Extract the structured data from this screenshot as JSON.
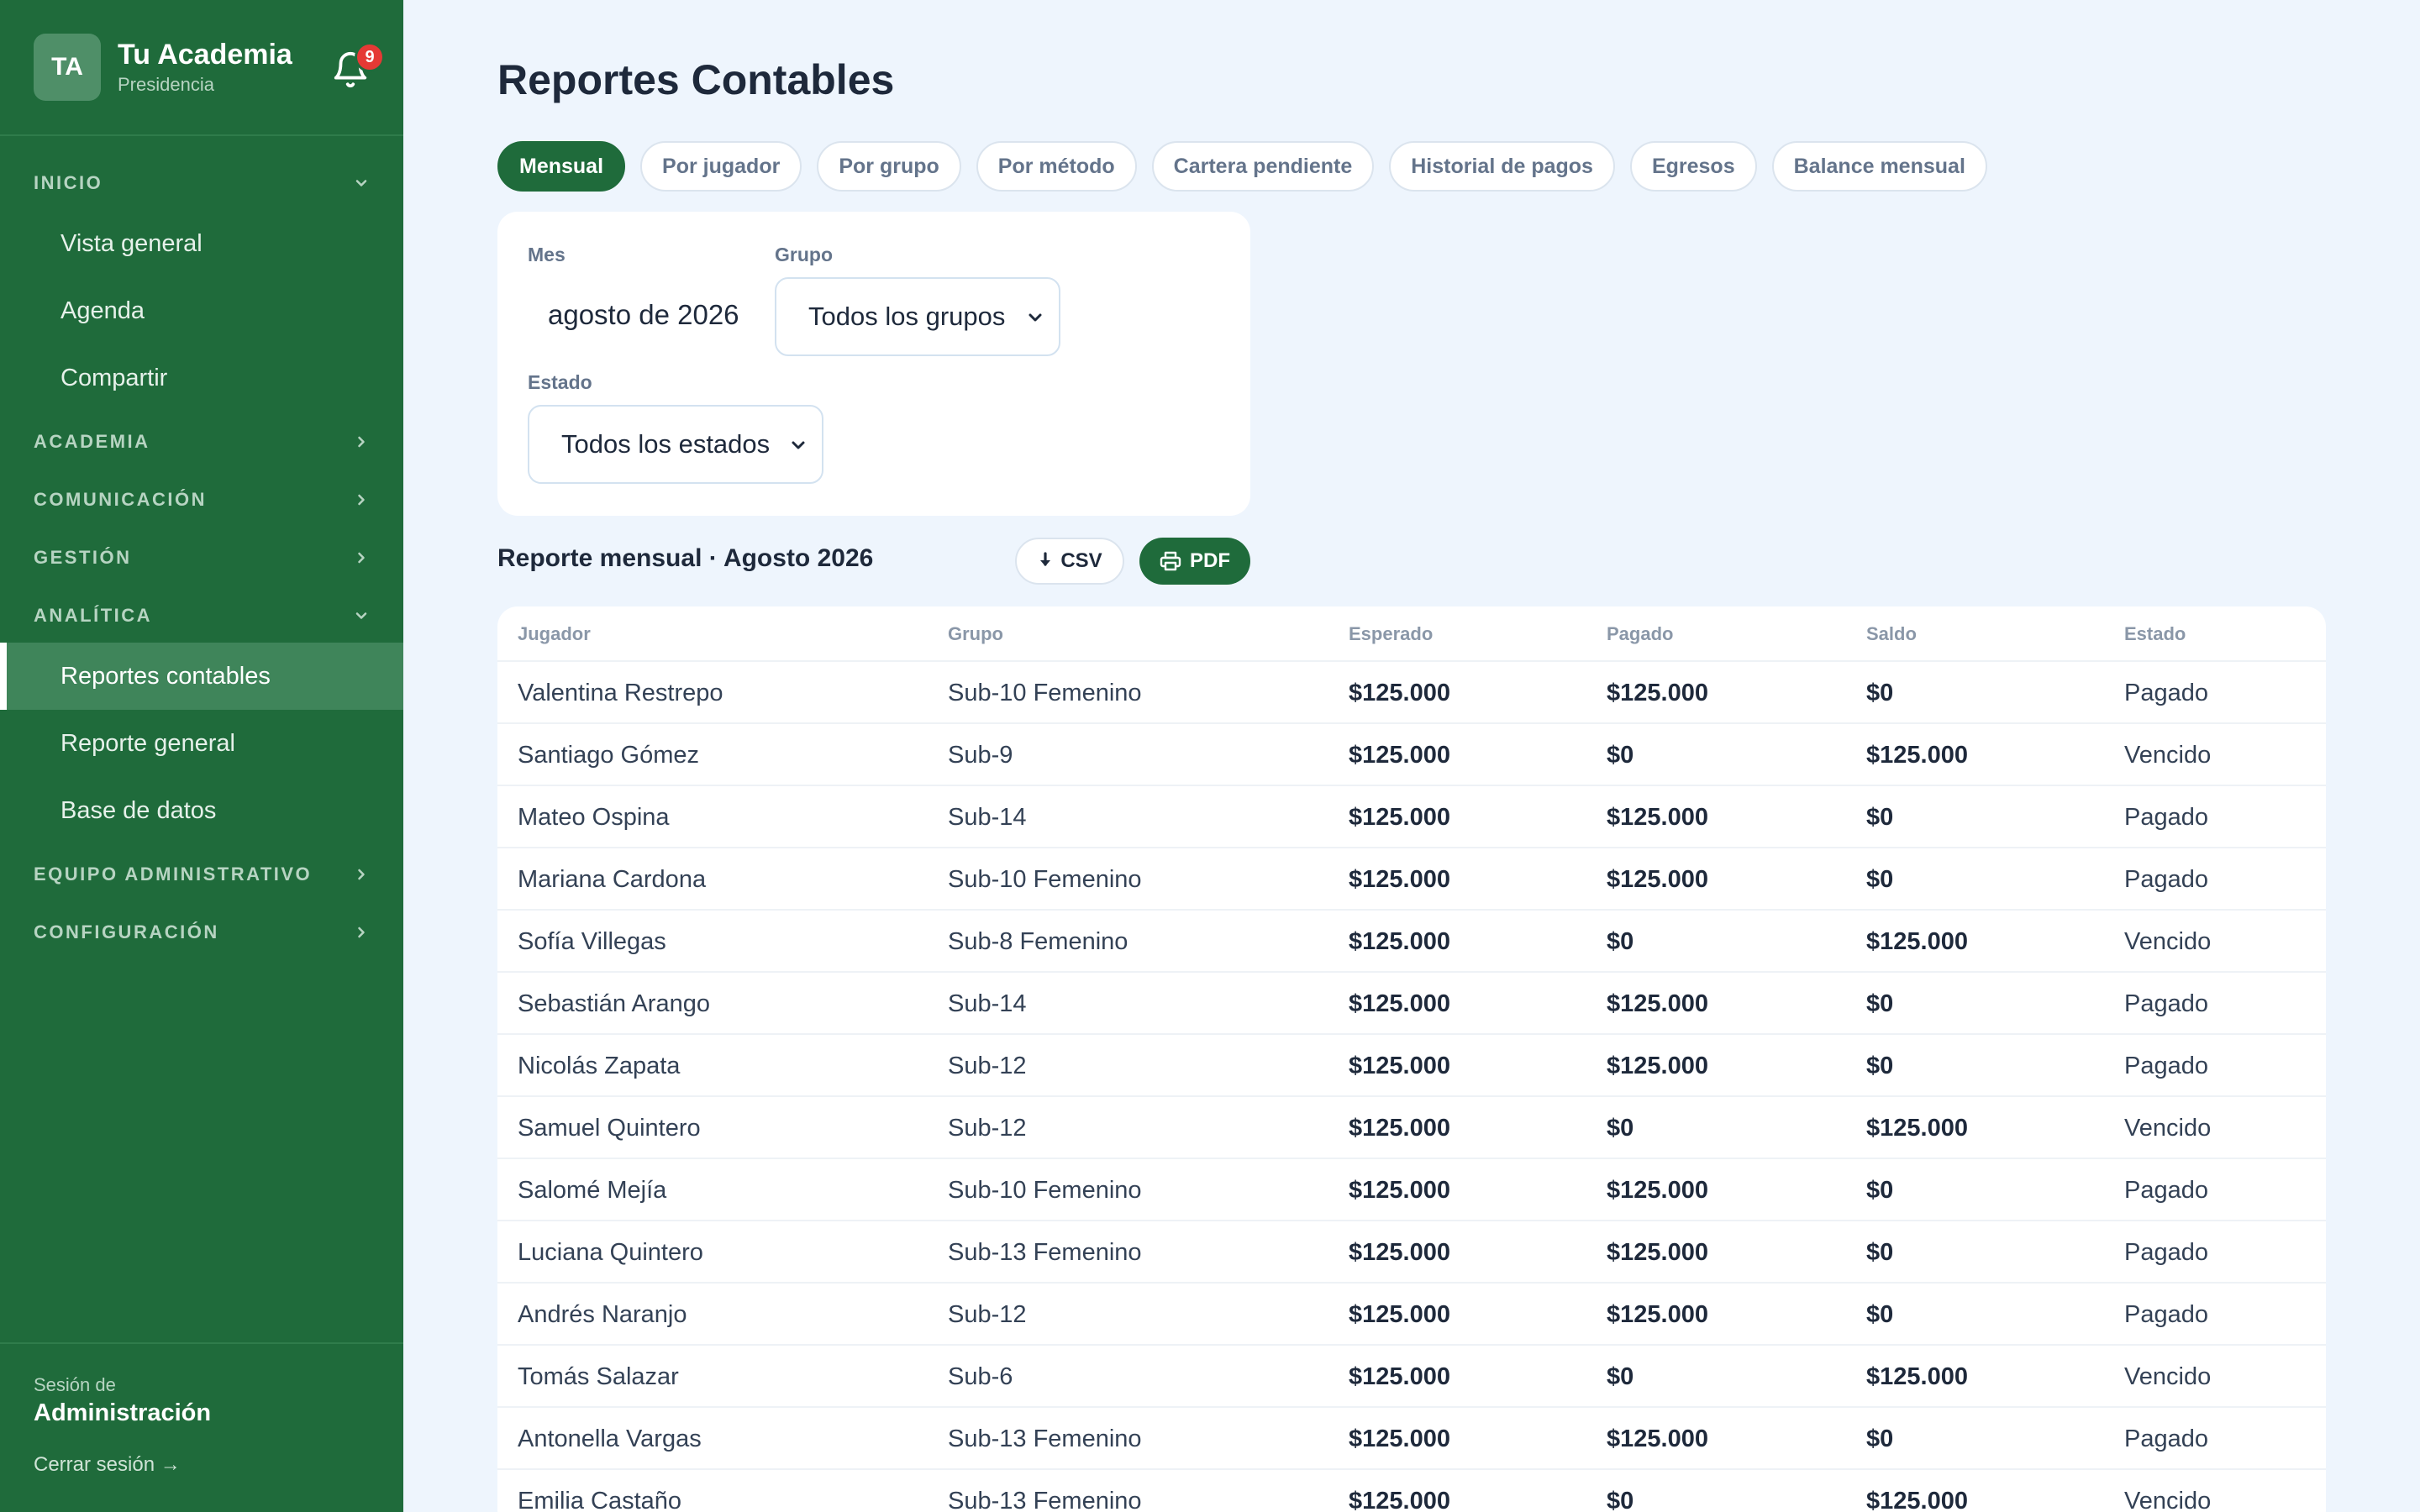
{
  "brand": {
    "initials": "TA",
    "name": "Tu Academia",
    "role": "Presidencia",
    "notifications": "9"
  },
  "sidebar": {
    "sections": [
      {
        "label": "INICIO",
        "expanded": true,
        "items": [
          "Vista general",
          "Agenda",
          "Compartir"
        ]
      },
      {
        "label": "ACADEMIA",
        "expanded": false,
        "items": []
      },
      {
        "label": "COMUNICACIÓN",
        "expanded": false,
        "items": []
      },
      {
        "label": "GESTIÓN",
        "expanded": false,
        "items": []
      },
      {
        "label": "ANALÍTICA",
        "expanded": true,
        "items": [
          "Reportes contables",
          "Reporte general",
          "Base de datos"
        ],
        "active_item": "Reportes contables"
      },
      {
        "label": "EQUIPO ADMINISTRATIVO",
        "expanded": false,
        "items": []
      },
      {
        "label": "CONFIGURACIÓN",
        "expanded": false,
        "items": []
      }
    ],
    "session_label": "Sesión de",
    "session_name": "Administración",
    "logout": "Cerrar sesión →"
  },
  "page": {
    "title": "Reportes Contables"
  },
  "tabs": {
    "items": [
      "Mensual",
      "Por jugador",
      "Por grupo",
      "Por método",
      "Cartera pendiente",
      "Historial de pagos",
      "Egresos",
      "Balance mensual"
    ],
    "active": "Mensual"
  },
  "filters": {
    "month_label": "Mes",
    "month_value": "agosto de 2026",
    "group_label": "Grupo",
    "group_value": "Todos los grupos",
    "status_label": "Estado",
    "status_value": "Todos los estados"
  },
  "report": {
    "title": "Reporte mensual · Agosto 2026",
    "csv_label": "CSV",
    "pdf_label": "PDF"
  },
  "table": {
    "columns": [
      "Jugador",
      "Grupo",
      "Esperado",
      "Pagado",
      "Saldo",
      "Estado"
    ],
    "rows": [
      [
        "Valentina Restrepo",
        "Sub-10 Femenino",
        "$125.000",
        "$125.000",
        "$0",
        "Pagado"
      ],
      [
        "Santiago Gómez",
        "Sub-9",
        "$125.000",
        "$0",
        "$125.000",
        "Vencido"
      ],
      [
        "Mateo Ospina",
        "Sub-14",
        "$125.000",
        "$125.000",
        "$0",
        "Pagado"
      ],
      [
        "Mariana Cardona",
        "Sub-10 Femenino",
        "$125.000",
        "$125.000",
        "$0",
        "Pagado"
      ],
      [
        "Sofía Villegas",
        "Sub-8 Femenino",
        "$125.000",
        "$0",
        "$125.000",
        "Vencido"
      ],
      [
        "Sebastián Arango",
        "Sub-14",
        "$125.000",
        "$125.000",
        "$0",
        "Pagado"
      ],
      [
        "Nicolás Zapata",
        "Sub-12",
        "$125.000",
        "$125.000",
        "$0",
        "Pagado"
      ],
      [
        "Samuel Quintero",
        "Sub-12",
        "$125.000",
        "$0",
        "$125.000",
        "Vencido"
      ],
      [
        "Salomé Mejía",
        "Sub-10 Femenino",
        "$125.000",
        "$125.000",
        "$0",
        "Pagado"
      ],
      [
        "Luciana Quintero",
        "Sub-13 Femenino",
        "$125.000",
        "$125.000",
        "$0",
        "Pagado"
      ],
      [
        "Andrés Naranjo",
        "Sub-12",
        "$125.000",
        "$125.000",
        "$0",
        "Pagado"
      ],
      [
        "Tomás Salazar",
        "Sub-6",
        "$125.000",
        "$0",
        "$125.000",
        "Vencido"
      ],
      [
        "Antonella Vargas",
        "Sub-13 Femenino",
        "$125.000",
        "$125.000",
        "$0",
        "Pagado"
      ],
      [
        "Emilia Castaño",
        "Sub-13 Femenino",
        "$125.000",
        "$0",
        "$125.000",
        "Vencido"
      ]
    ]
  },
  "colors": {
    "sidebar": "#1f6b3b",
    "accent": "#1f6b3b",
    "background": "#eef5fd",
    "badge": "#e53935"
  },
  "icons": {
    "notifications": "bell-icon",
    "csv": "download-icon",
    "pdf": "printer-icon",
    "expanded": "chevron-down-icon",
    "collapsed": "chevron-right-icon"
  }
}
